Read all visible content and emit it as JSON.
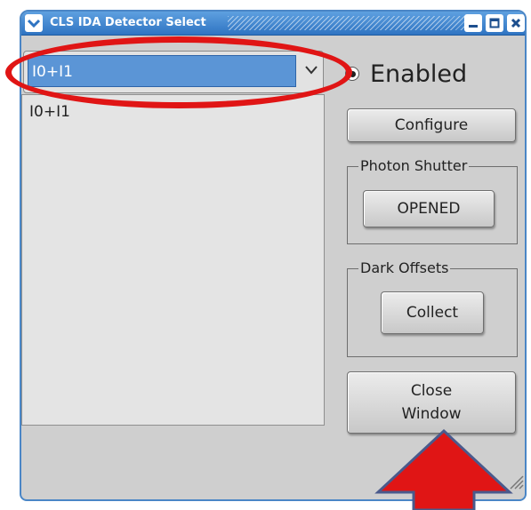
{
  "window": {
    "title": "CLS IDA Detector Select"
  },
  "detector_select": {
    "selected": "I0+I1",
    "list_items": [
      "I0+I1"
    ]
  },
  "enabled_radio": {
    "label": "Enabled",
    "checked": true
  },
  "buttons": {
    "configure": "Configure",
    "shutter": "OPENED",
    "collect": "Collect",
    "close_line1": "Close",
    "close_line2": "Window"
  },
  "groups": {
    "photon_shutter": "Photon Shutter",
    "dark_offsets": "Dark Offsets"
  },
  "colors": {
    "titlebar": "#3b84d2",
    "selection": "#5b95d6",
    "annotation": "#e01515",
    "annotation_outline": "#4a5a8c"
  },
  "icons": [
    "menu-chevron-icon",
    "minimize-icon",
    "maximize-icon",
    "close-icon",
    "resize-grip-icon"
  ]
}
